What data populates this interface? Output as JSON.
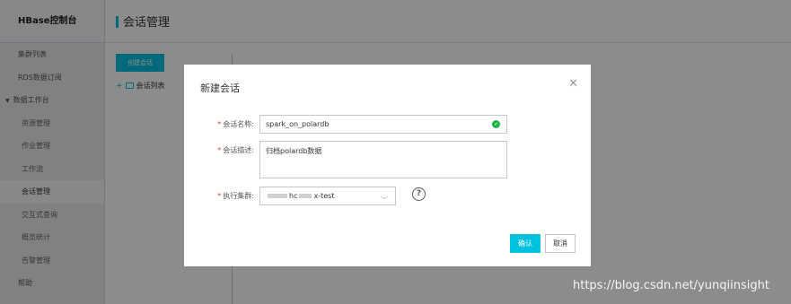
{
  "sidebar": {
    "brand": "HBase控制台",
    "items": [
      {
        "label": "集群列表"
      },
      {
        "label": "RDS数据订阅"
      },
      {
        "label": "数据工作台"
      },
      {
        "label": "资源管理"
      },
      {
        "label": "作业管理"
      },
      {
        "label": "工作流"
      },
      {
        "label": "会话管理"
      },
      {
        "label": "交互式查询"
      },
      {
        "label": "概览统计"
      },
      {
        "label": "告警管理"
      },
      {
        "label": "帮助"
      }
    ]
  },
  "header": {
    "title": "会话管理",
    "accent": "#00c1de"
  },
  "content": {
    "create_button": "创建会话",
    "tree_root": "会话列表"
  },
  "dialog": {
    "title": "新建会话",
    "close_icon": "close-icon",
    "name_label": "会话名称:",
    "name_value": "spark_on_polardb",
    "desc_label": "会话描述:",
    "desc_value": "归档polardb数据",
    "cluster_label": "执行集群:",
    "cluster_prefix": "hc",
    "cluster_suffix": "x-test",
    "confirm": "确认",
    "cancel": "取消"
  },
  "watermark": "https://blog.csdn.net/yunqiinsight"
}
